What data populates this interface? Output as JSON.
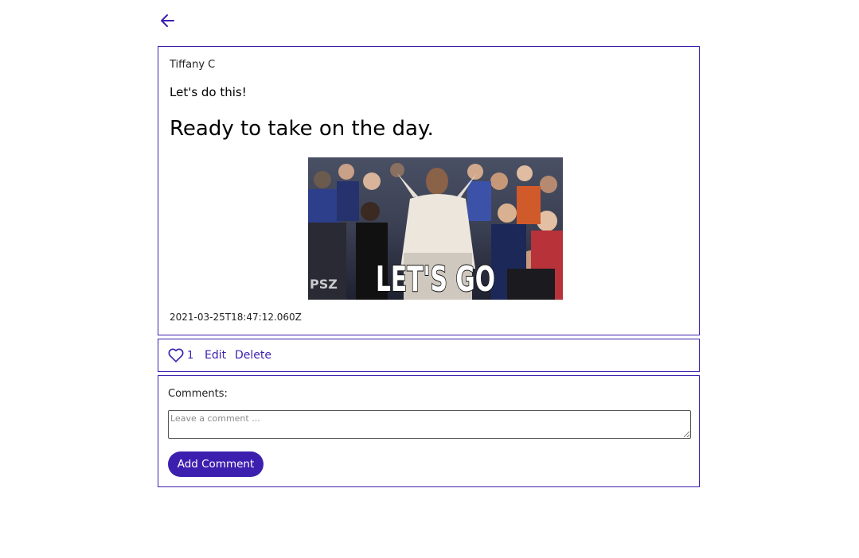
{
  "nav": {
    "back_icon": "arrow-left-icon"
  },
  "post": {
    "author": "Tiffany C",
    "title": "Let's do this!",
    "body": "Ready to take on the day.",
    "gif_caption": "LET'S GO",
    "gif_watermark": "PSZ",
    "timestamp": "2021-03-25T18:47:12.060Z"
  },
  "actions": {
    "like_icon": "heart-icon",
    "like_count": "1",
    "edit_label": "Edit",
    "delete_label": "Delete"
  },
  "comments": {
    "label": "Comments:",
    "input_value": "",
    "input_placeholder": "Leave a comment ...",
    "submit_label": "Add Comment"
  },
  "colors": {
    "accent": "#3d1fb0",
    "border": "#3d1fb0",
    "text": "#111111",
    "background": "#ffffff"
  }
}
